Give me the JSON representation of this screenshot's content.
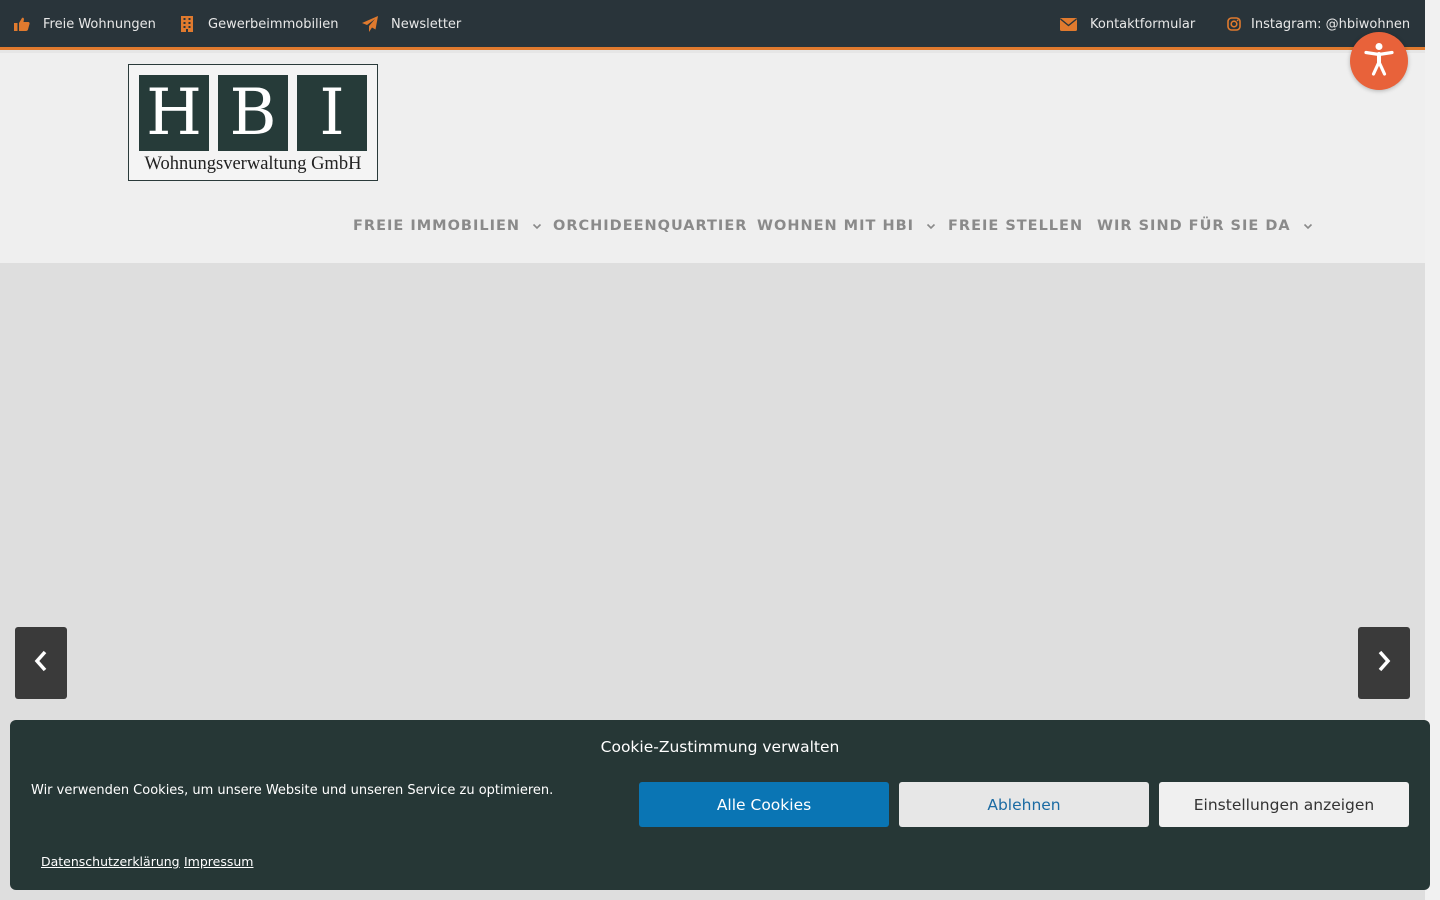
{
  "topbar": {
    "left": [
      {
        "label": "Freie Wohnungen",
        "icon": "thumbs-up-icon"
      },
      {
        "label": "Gewerbeimmobilien",
        "icon": "building-icon"
      },
      {
        "label": "Newsletter",
        "icon": "paper-plane-icon"
      }
    ],
    "right": [
      {
        "label": "Kontaktformular",
        "icon": "envelope-icon"
      },
      {
        "label": "Instagram: @hbiwohnen",
        "icon": "instagram-icon"
      }
    ]
  },
  "logo": {
    "letters": [
      "H",
      "B",
      "I"
    ],
    "subtitle": "Wohnungsverwaltung GmbH"
  },
  "nav": {
    "items": [
      {
        "label": "FREIE IMMOBILIEN",
        "dropdown": true
      },
      {
        "label": "ORCHIDEENQUARTIER",
        "dropdown": false
      },
      {
        "label": "WOHNEN MIT HBI",
        "dropdown": true
      },
      {
        "label": "FREIE STELLEN",
        "dropdown": false
      },
      {
        "label": "WIR SIND FÜR SIE DA",
        "dropdown": true
      }
    ]
  },
  "cookie": {
    "title": "Cookie-Zustimmung verwalten",
    "text": "Wir verwenden Cookies, um unsere Website und unseren Service zu optimieren.",
    "accept_label": "Alle Cookies",
    "deny_label": "Ablehnen",
    "prefs_label": "Einstellungen anzeigen",
    "links": [
      "Datenschutzerklärung",
      "Impressum"
    ]
  },
  "colors": {
    "accent": "#e07a2e",
    "topbar_bg": "#29343a",
    "cookie_bg": "#263736",
    "accept_btn": "#0a75b4",
    "a11y_button": "#e8623a"
  }
}
